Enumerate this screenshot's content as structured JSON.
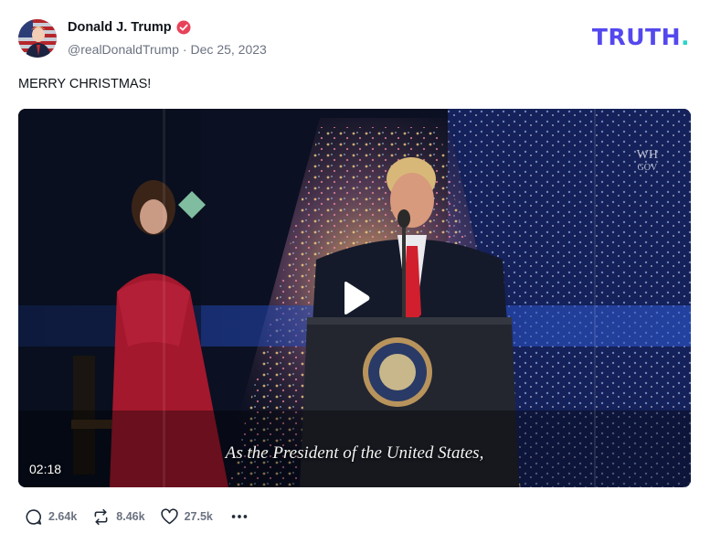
{
  "author": {
    "display_name": "Donald J. Trump",
    "handle": "@realDonaldTrump",
    "separator": "·",
    "date": "Dec 25, 2023"
  },
  "brand": {
    "wordmark": "TRUTH",
    "dot": ".",
    "color": "#5448ee",
    "dot_color": "#2bd4c9"
  },
  "post": {
    "text": "MERRY CHRISTMAS!"
  },
  "media": {
    "type": "video",
    "duration": "02:18",
    "caption": "As the President of the United States,",
    "watermark_line1": "WH",
    "watermark_line2": "GOV"
  },
  "actions": {
    "replies": "2.64k",
    "retruths": "8.46k",
    "likes": "27.5k"
  },
  "colors": {
    "verified": "#e8425a",
    "muted": "#6b7280"
  }
}
